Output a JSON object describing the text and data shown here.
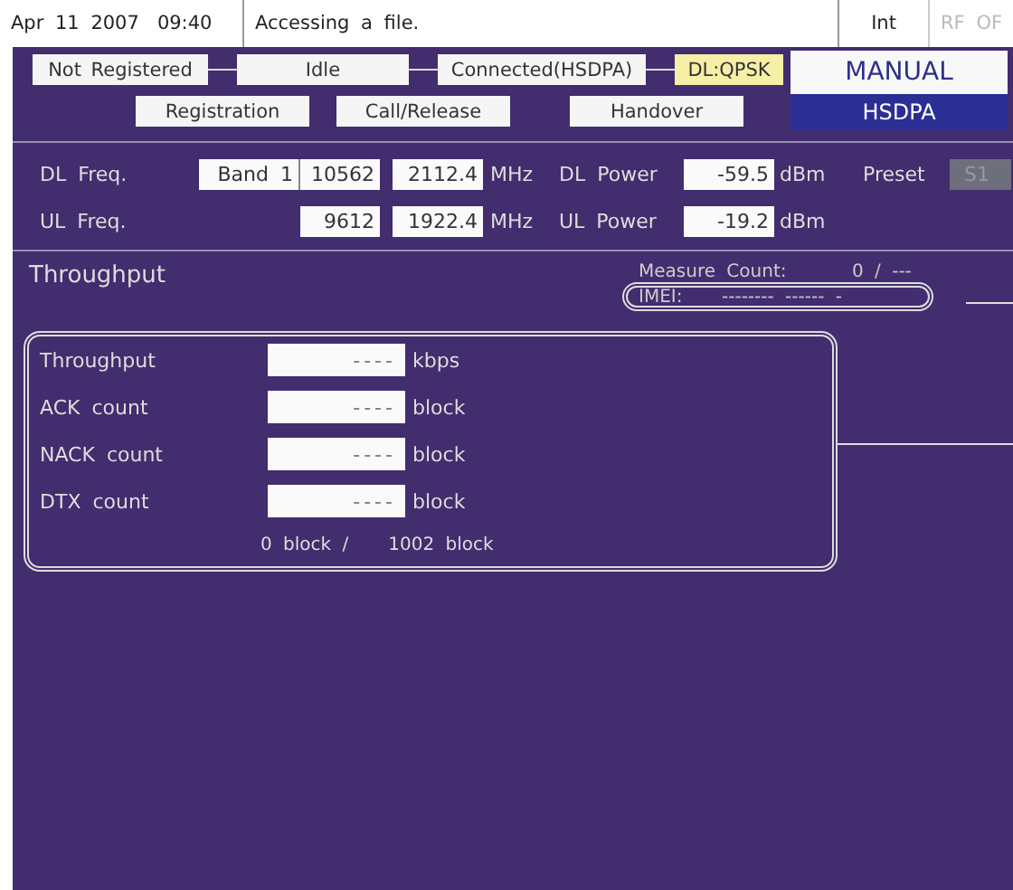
{
  "status_bar": {
    "date": "Apr 11 2007",
    "time": "09:40",
    "message": "Accessing a file.",
    "indicators": [
      {
        "label": "Int",
        "disabled": false
      },
      {
        "label": "RF OF",
        "disabled": true
      }
    ]
  },
  "call_states": [
    {
      "label": "Not Registered",
      "kind": "state"
    },
    {
      "label": "Idle",
      "kind": "state"
    },
    {
      "label": "Connected(HSDPA)",
      "kind": "state"
    },
    {
      "label": "DL:QPSK",
      "kind": "modulation"
    }
  ],
  "actions": [
    "Registration",
    "Call/Release",
    "Handover"
  ],
  "mode": {
    "label": "MANUAL",
    "system": "HSDPA"
  },
  "frequencies": [
    {
      "label": "DL Freq.",
      "band": "Band 1",
      "channel": "10562",
      "frequency": "2112.4",
      "frequency_unit": "MHz",
      "power_label": "DL Power",
      "power": "-59.5",
      "power_unit": "dBm",
      "preset_label": "Preset",
      "preset": "S1"
    },
    {
      "label": "UL Freq.",
      "channel": "9612",
      "frequency": "1922.4",
      "frequency_unit": "MHz",
      "power_label": "UL Power",
      "power": "-19.2",
      "power_unit": "dBm"
    }
  ],
  "measurement": {
    "title": "Throughput",
    "measure_count_label": "Measure Count:",
    "measure_count": "0 / ---",
    "imei_label": "IMEI:",
    "imei": "-------- ------ -"
  },
  "results": {
    "rows": [
      {
        "label": "Throughput",
        "value": "----",
        "unit": "kbps"
      },
      {
        "label": "ACK count",
        "value": "----",
        "unit": "block"
      },
      {
        "label": "NACK count",
        "value": "----",
        "unit": "block"
      },
      {
        "label": "DTX count",
        "value": "----",
        "unit": "block"
      }
    ],
    "blocks_done": "0 block /",
    "blocks_total": "1002 block"
  }
}
